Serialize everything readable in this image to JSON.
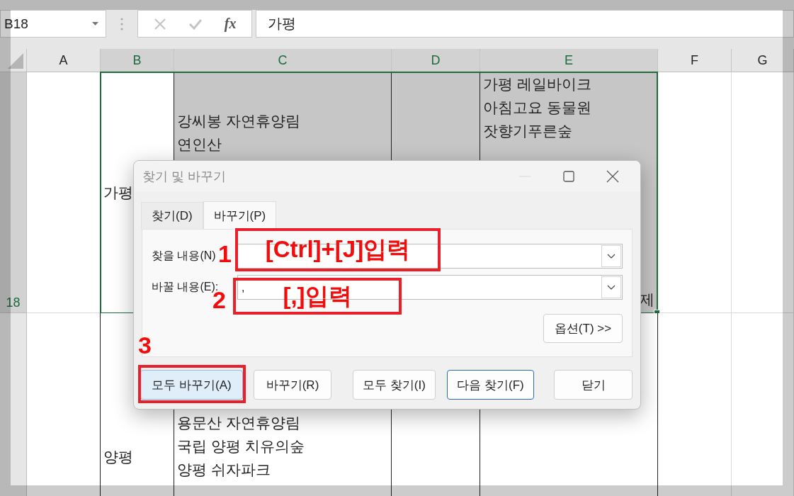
{
  "formula_bar": {
    "name_box": "B18",
    "function_label": "fx",
    "cell_value": "가평"
  },
  "columns": [
    {
      "label": "A",
      "selected": false
    },
    {
      "label": "B",
      "selected": true
    },
    {
      "label": "C",
      "selected": true
    },
    {
      "label": "D",
      "selected": true
    },
    {
      "label": "E",
      "selected": true
    },
    {
      "label": "F",
      "selected": false
    },
    {
      "label": "G",
      "selected": false
    }
  ],
  "rows": [
    {
      "number": "18",
      "selected": true,
      "b": "가평",
      "c": [
        "강씨봉 자연휴양림",
        "연인산"
      ],
      "e": [
        "가평 레일바이크",
        "아침고요 동물원",
        "잣향기푸른숲"
      ],
      "e_tail": "제"
    },
    {
      "selected": false,
      "b": "양평",
      "c": [
        "용문산 자연휴양림",
        "국립 양평 치유의숲",
        "양평 쉬자파크"
      ]
    }
  ],
  "dialog": {
    "title": "찾기 및 바꾸기",
    "tabs": [
      {
        "label": "찾기(D)",
        "selected": false
      },
      {
        "label": "바꾸기(P)",
        "selected": true
      }
    ],
    "fields": [
      {
        "label": "찾을 내용(N)"
      },
      {
        "label": "바꿀 내용(E):",
        "value": ","
      }
    ],
    "options_button": "옵션(T) >>",
    "buttons": [
      {
        "label": "모두 바꾸기(A)",
        "highlighted": true,
        "focused": false
      },
      {
        "label": "바꾸기(R)",
        "highlighted": false,
        "focused": false
      },
      {
        "label": "모두 찾기(I)",
        "highlighted": false,
        "focused": false
      },
      {
        "label": "다음 찾기(F)",
        "highlighted": false,
        "focused": true
      },
      {
        "label": "닫기",
        "highlighted": false,
        "focused": false
      }
    ]
  },
  "annotations": [
    {
      "number": "1",
      "text": "[Ctrl]+[J]입력"
    },
    {
      "number": "2",
      "text": "[,]입력"
    },
    {
      "number": "3"
    }
  ]
}
